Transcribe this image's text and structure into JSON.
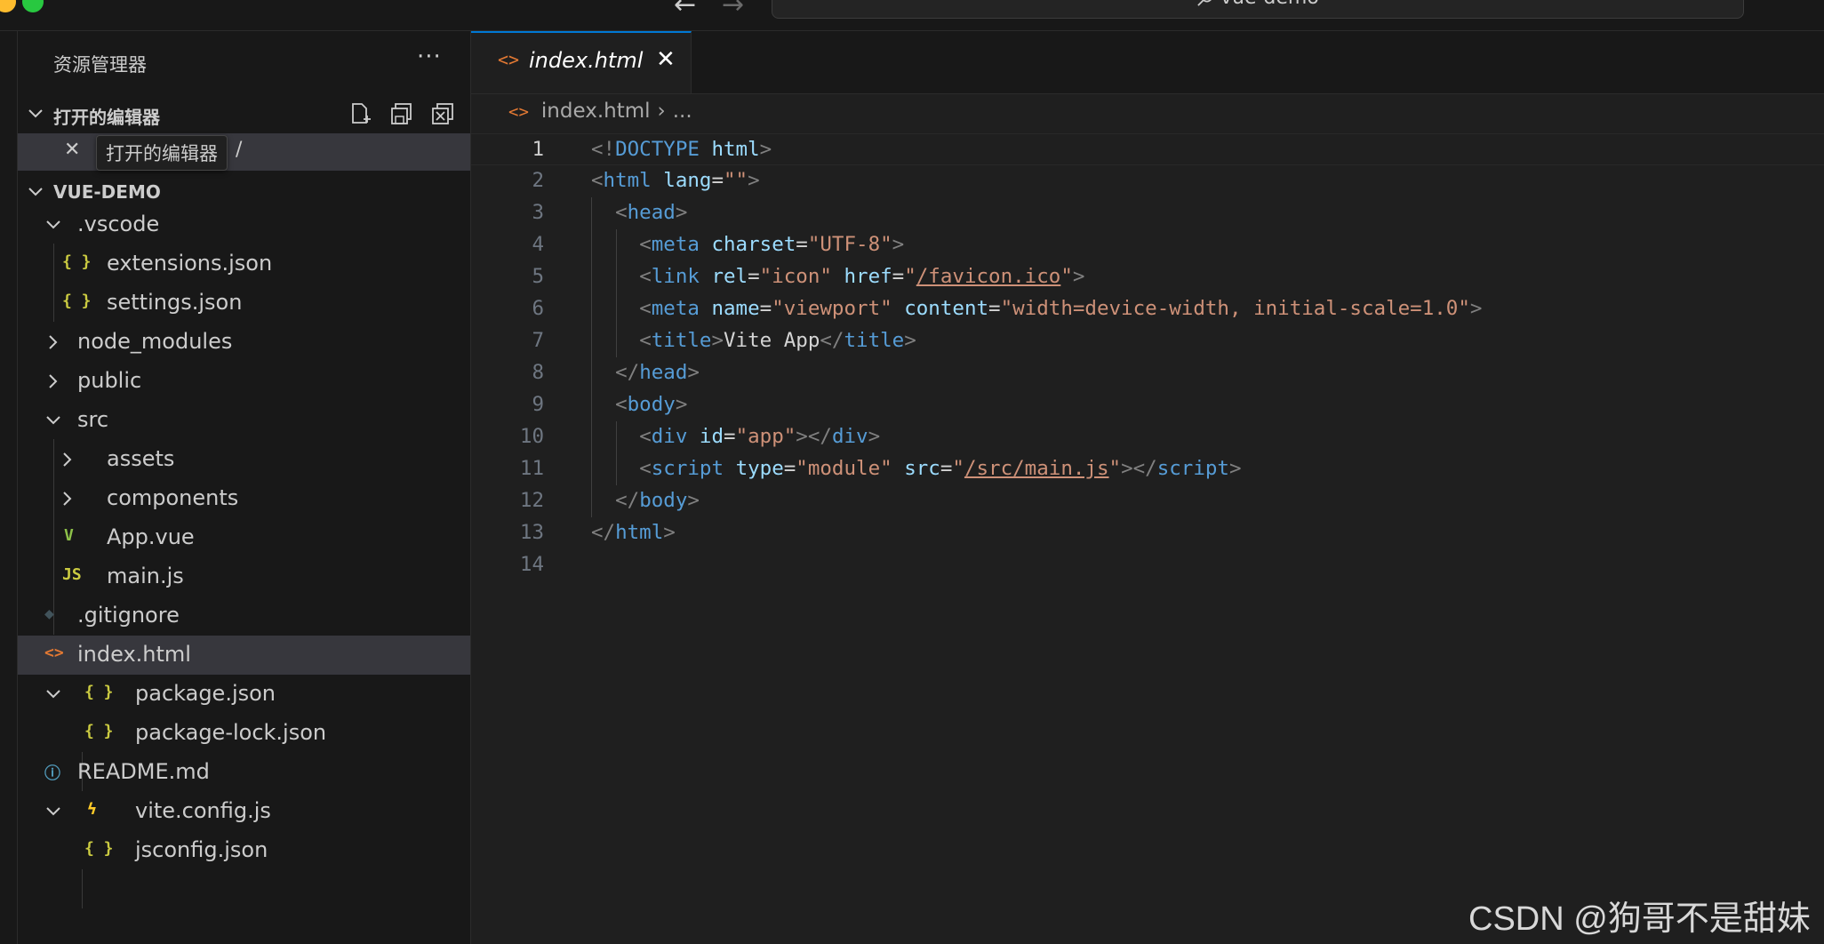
{
  "window": {
    "search_text": "vue-demo"
  },
  "sidebar": {
    "title": "资源管理器",
    "more_label": "···",
    "open_editors": {
      "header": "打开的编辑器",
      "tooltip": "打开的编辑器",
      "row_close": "✕",
      "row_suffix": "/"
    },
    "project": {
      "header": "VUE-DEMO",
      "items": [
        {
          "label": ".vscode",
          "icon": "",
          "icon_color": ""
        },
        {
          "label": "extensions.json",
          "icon": "{ }",
          "icon_color": "#cbcb41"
        },
        {
          "label": "settings.json",
          "icon": "{ }",
          "icon_color": "#cbcb41"
        },
        {
          "label": "node_modules",
          "icon": "",
          "icon_color": ""
        },
        {
          "label": "public",
          "icon": "",
          "icon_color": ""
        },
        {
          "label": "src",
          "icon": "",
          "icon_color": ""
        },
        {
          "label": "assets",
          "icon": "",
          "icon_color": ""
        },
        {
          "label": "components",
          "icon": "",
          "icon_color": ""
        },
        {
          "label": "App.vue",
          "icon": "V",
          "icon_color": "#8dc149"
        },
        {
          "label": "main.js",
          "icon": "JS",
          "icon_color": "#cbcb41"
        },
        {
          "label": ".gitignore",
          "icon": "◆",
          "icon_color": "#41535b"
        },
        {
          "label": "index.html",
          "icon": "<>",
          "icon_color": "#e37933"
        },
        {
          "label": "package.json",
          "icon": "{ }",
          "icon_color": "#cbcb41"
        },
        {
          "label": "package-lock.json",
          "icon": "{ }",
          "icon_color": "#cbcb41"
        },
        {
          "label": "README.md",
          "icon": "ⓘ",
          "icon_color": "#519aba"
        },
        {
          "label": "vite.config.js",
          "icon": "ϟ",
          "icon_color": "#ffca28"
        },
        {
          "label": "jsconfig.json",
          "icon": "{ }",
          "icon_color": "#cbcb41"
        }
      ]
    }
  },
  "editor": {
    "tab": {
      "icon": "<>",
      "label": "index.html",
      "close": "✕"
    },
    "breadcrumb": {
      "icon": "<>",
      "file": "index.html",
      "sep": "›",
      "rest": "..."
    },
    "lines": [
      [
        [
          "br",
          "<!"
        ],
        [
          "tag",
          "DOCTYPE"
        ],
        [
          "txt",
          " "
        ],
        [
          "attr",
          "html"
        ],
        [
          "br",
          ">"
        ]
      ],
      [
        [
          "br",
          "<"
        ],
        [
          "tag",
          "html"
        ],
        [
          "txt",
          " "
        ],
        [
          "attr",
          "lang"
        ],
        [
          "txt",
          "="
        ],
        [
          "str",
          "\"\""
        ],
        [
          "br",
          ">"
        ]
      ],
      [
        [
          "txt",
          "  "
        ],
        [
          "br",
          "<"
        ],
        [
          "tag",
          "head"
        ],
        [
          "br",
          ">"
        ]
      ],
      [
        [
          "txt",
          "    "
        ],
        [
          "br",
          "<"
        ],
        [
          "tag",
          "meta"
        ],
        [
          "txt",
          " "
        ],
        [
          "attr",
          "charset"
        ],
        [
          "txt",
          "="
        ],
        [
          "str",
          "\"UTF-8\""
        ],
        [
          "br",
          ">"
        ]
      ],
      [
        [
          "txt",
          "    "
        ],
        [
          "br",
          "<"
        ],
        [
          "tag",
          "link"
        ],
        [
          "txt",
          " "
        ],
        [
          "attr",
          "rel"
        ],
        [
          "txt",
          "="
        ],
        [
          "str",
          "\"icon\""
        ],
        [
          "txt",
          " "
        ],
        [
          "attr",
          "href"
        ],
        [
          "txt",
          "="
        ],
        [
          "str",
          "\""
        ],
        [
          "strU",
          "/favicon.ico"
        ],
        [
          "str",
          "\""
        ],
        [
          "br",
          ">"
        ]
      ],
      [
        [
          "txt",
          "    "
        ],
        [
          "br",
          "<"
        ],
        [
          "tag",
          "meta"
        ],
        [
          "txt",
          " "
        ],
        [
          "attr",
          "name"
        ],
        [
          "txt",
          "="
        ],
        [
          "str",
          "\"viewport\""
        ],
        [
          "txt",
          " "
        ],
        [
          "attr",
          "content"
        ],
        [
          "txt",
          "="
        ],
        [
          "str",
          "\"width=device-width, initial-scale=1.0\""
        ],
        [
          "br",
          ">"
        ]
      ],
      [
        [
          "txt",
          "    "
        ],
        [
          "br",
          "<"
        ],
        [
          "tag",
          "title"
        ],
        [
          "br",
          ">"
        ],
        [
          "txt",
          "Vite App"
        ],
        [
          "br",
          "</"
        ],
        [
          "tag",
          "title"
        ],
        [
          "br",
          ">"
        ]
      ],
      [
        [
          "txt",
          "  "
        ],
        [
          "br",
          "</"
        ],
        [
          "tag",
          "head"
        ],
        [
          "br",
          ">"
        ]
      ],
      [
        [
          "txt",
          "  "
        ],
        [
          "br",
          "<"
        ],
        [
          "tag",
          "body"
        ],
        [
          "br",
          ">"
        ]
      ],
      [
        [
          "txt",
          "    "
        ],
        [
          "br",
          "<"
        ],
        [
          "tag",
          "div"
        ],
        [
          "txt",
          " "
        ],
        [
          "attr",
          "id"
        ],
        [
          "txt",
          "="
        ],
        [
          "str",
          "\"app\""
        ],
        [
          "br",
          "></"
        ],
        [
          "tag",
          "div"
        ],
        [
          "br",
          ">"
        ]
      ],
      [
        [
          "txt",
          "    "
        ],
        [
          "br",
          "<"
        ],
        [
          "tag",
          "script"
        ],
        [
          "txt",
          " "
        ],
        [
          "attr",
          "type"
        ],
        [
          "txt",
          "="
        ],
        [
          "str",
          "\"module\""
        ],
        [
          "txt",
          " "
        ],
        [
          "attr",
          "src"
        ],
        [
          "txt",
          "="
        ],
        [
          "str",
          "\""
        ],
        [
          "strU",
          "/src/main.js"
        ],
        [
          "str",
          "\""
        ],
        [
          "br",
          "></"
        ],
        [
          "tag",
          "script"
        ],
        [
          "br",
          ">"
        ]
      ],
      [
        [
          "txt",
          "  "
        ],
        [
          "br",
          "</"
        ],
        [
          "tag",
          "body"
        ],
        [
          "br",
          ">"
        ]
      ],
      [
        [
          "br",
          "</"
        ],
        [
          "tag",
          "html"
        ],
        [
          "br",
          ">"
        ]
      ],
      []
    ],
    "line_numbers": [
      "1",
      "2",
      "3",
      "4",
      "5",
      "6",
      "7",
      "8",
      "9",
      "10",
      "11",
      "12",
      "13",
      "14"
    ],
    "current_line": 1
  },
  "watermark": "CSDN @狗哥不是甜妹"
}
